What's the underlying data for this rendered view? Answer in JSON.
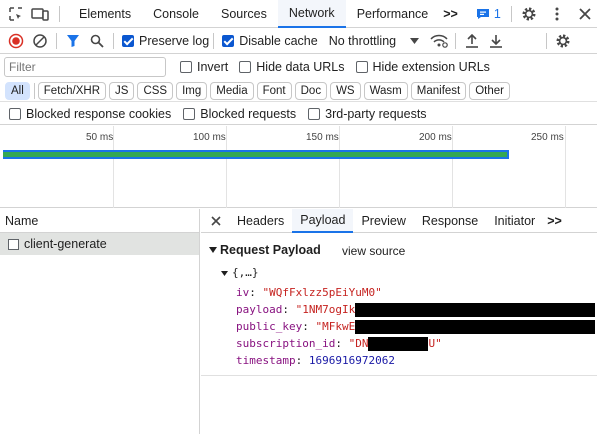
{
  "topbar": {
    "tabs": [
      "Elements",
      "Console",
      "Sources",
      "Network",
      "Performance"
    ],
    "active_tab": "Network",
    "more_label": ">>",
    "issues_count": "1"
  },
  "toolbar": {
    "preserve_log_label": "Preserve log",
    "preserve_log_checked": true,
    "disable_cache_label": "Disable cache",
    "disable_cache_checked": true,
    "throttling_value": "No throttling"
  },
  "filter": {
    "placeholder": "Filter",
    "invert_label": "Invert",
    "hide_data_urls_label": "Hide data URLs",
    "hide_extension_urls_label": "Hide extension URLs"
  },
  "type_filters": [
    "All",
    "Fetch/XHR",
    "JS",
    "CSS",
    "Img",
    "Media",
    "Font",
    "Doc",
    "WS",
    "Wasm",
    "Manifest",
    "Other"
  ],
  "blocked": {
    "blocked_cookies_label": "Blocked response cookies",
    "blocked_requests_label": "Blocked requests",
    "third_party_label": "3rd-party requests"
  },
  "timeline": {
    "ticks": [
      "50 ms",
      "100 ms",
      "150 ms",
      "200 ms",
      "250 ms"
    ]
  },
  "requests": {
    "header": "Name",
    "items": [
      "client-generate"
    ]
  },
  "details": {
    "tabs": [
      "Headers",
      "Payload",
      "Preview",
      "Response",
      "Initiator"
    ],
    "active_tab": "Payload",
    "more_label": ">>",
    "section_title": "Request Payload",
    "view_source_label": "view source",
    "object_summary": "{,…}",
    "props": {
      "iv_key": "iv",
      "iv_val": "\"WQfFxlzz5pEiYuM0\"",
      "payload_key": "payload",
      "payload_val": "\"1NM7ogIk",
      "public_key_key": "public_key",
      "public_key_val": "\"MFkwE",
      "subscription_id_key": "subscription_id",
      "subscription_id_val_start": "\"DN",
      "subscription_id_val_end": "U\"",
      "timestamp_key": "timestamp",
      "timestamp_val": "1696916972062"
    }
  },
  "colors": {
    "accent": "#1a73e8",
    "bar_green": "#34a853",
    "bar_blue": "#1a73e8"
  }
}
